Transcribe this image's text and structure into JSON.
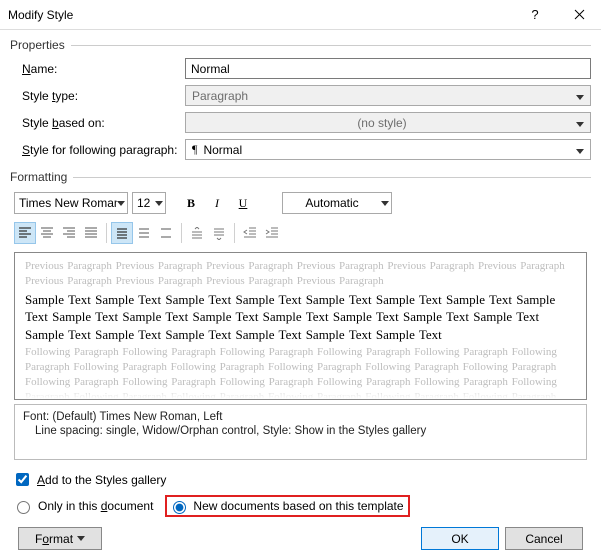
{
  "title": "Modify Style",
  "groups": {
    "properties": "Properties",
    "formatting": "Formatting"
  },
  "fields": {
    "name": {
      "label": "Name:",
      "value": "Normal"
    },
    "styleType": {
      "label": "Style type:",
      "value": "Paragraph"
    },
    "basedOn": {
      "label": "Style based on:",
      "value": "(no style)"
    },
    "following": {
      "label": "Style for following paragraph:",
      "value": "Normal"
    }
  },
  "font": {
    "name": "Times New Roman",
    "size": "12",
    "colorLabel": "Automatic"
  },
  "preview": {
    "prev": "Previous Paragraph Previous Paragraph Previous Paragraph Previous Paragraph Previous Paragraph Previous Paragraph Previous Paragraph Previous Paragraph Previous Paragraph Previous Paragraph",
    "sample": "Sample Text Sample Text Sample Text Sample Text Sample Text Sample Text Sample Text Sample Text Sample Text Sample Text Sample Text Sample Text Sample Text Sample Text Sample Text Sample Text Sample Text Sample Text Sample Text Sample Text Sample Text",
    "next": "Following Paragraph Following Paragraph Following Paragraph Following Paragraph Following Paragraph Following Paragraph Following Paragraph Following Paragraph Following Paragraph Following Paragraph Following Paragraph Following Paragraph Following Paragraph Following Paragraph Following Paragraph Following Paragraph Following Paragraph Following Paragraph Following Paragraph Following Paragraph Following Paragraph Following Paragraph Following Paragraph Following Paragraph Following Paragraph"
  },
  "description": {
    "line1": "Font: (Default) Times New Roman, Left",
    "line2": "Line spacing:  single, Widow/Orphan control, Style: Show in the Styles gallery"
  },
  "options": {
    "addToGallery": "Add to the Styles gallery",
    "onlyDoc": "Only in this document",
    "newDocs": "New documents based on this template"
  },
  "buttons": {
    "format": "Format",
    "ok": "OK",
    "cancel": "Cancel"
  }
}
